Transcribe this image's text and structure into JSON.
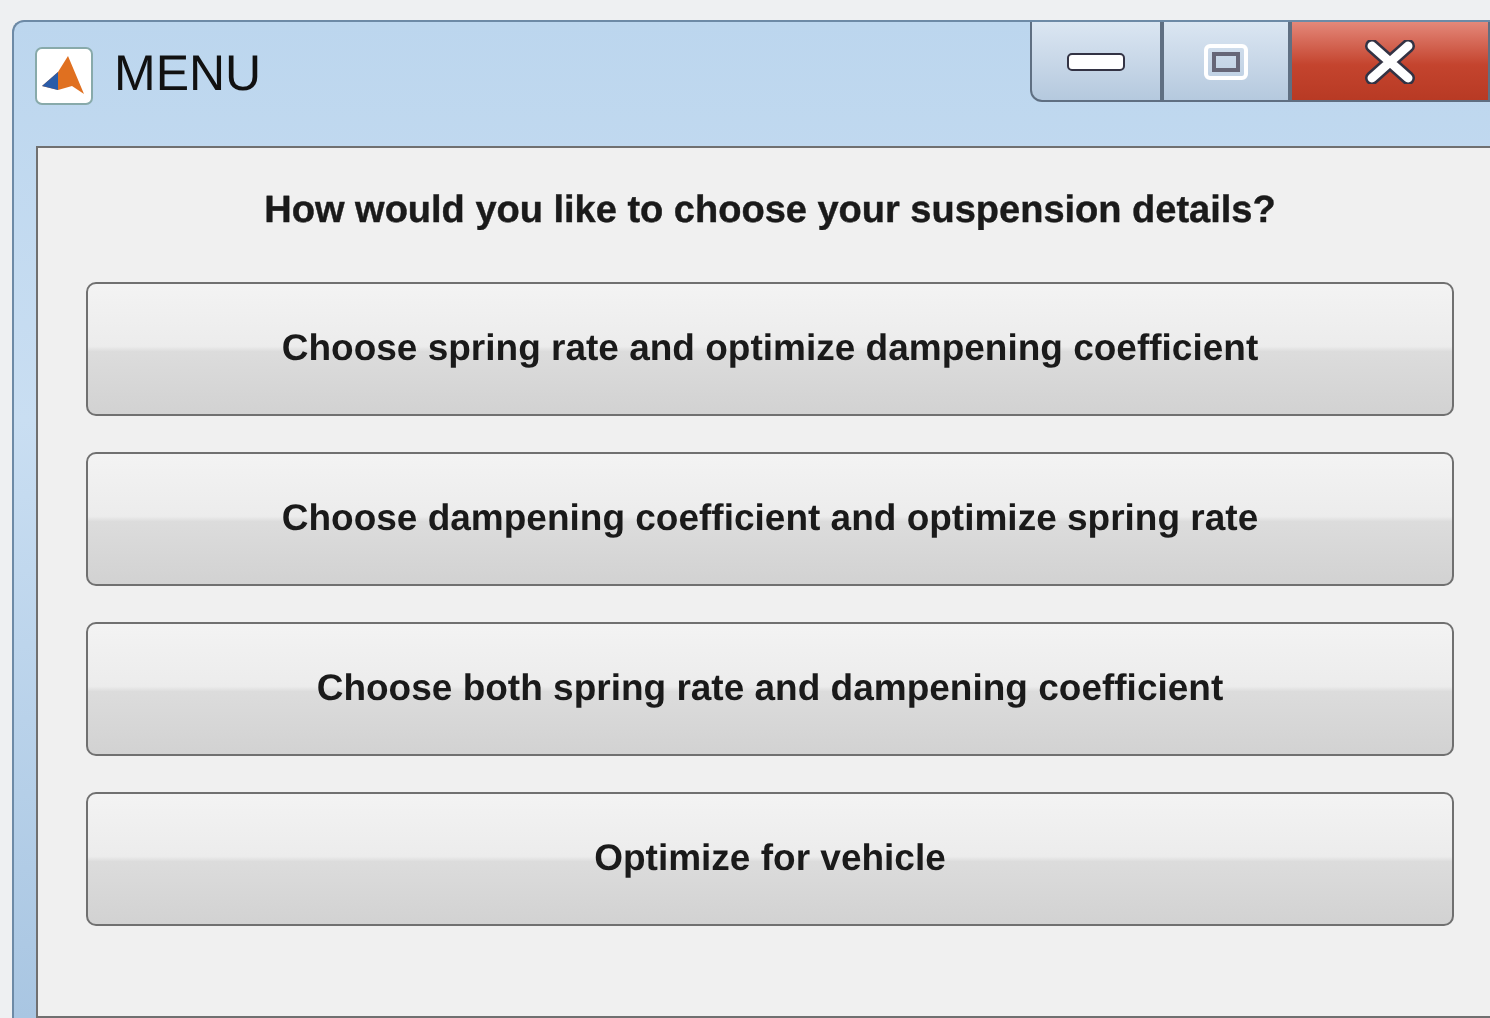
{
  "window": {
    "title": "MENU"
  },
  "prompt": "How would you like to choose your suspension details?",
  "buttons": [
    "Choose spring rate and optimize dampening coefficient",
    "Choose dampening coefficient and optimize spring rate",
    "Choose both spring rate and dampening coefficient",
    "Optimize for vehicle"
  ]
}
